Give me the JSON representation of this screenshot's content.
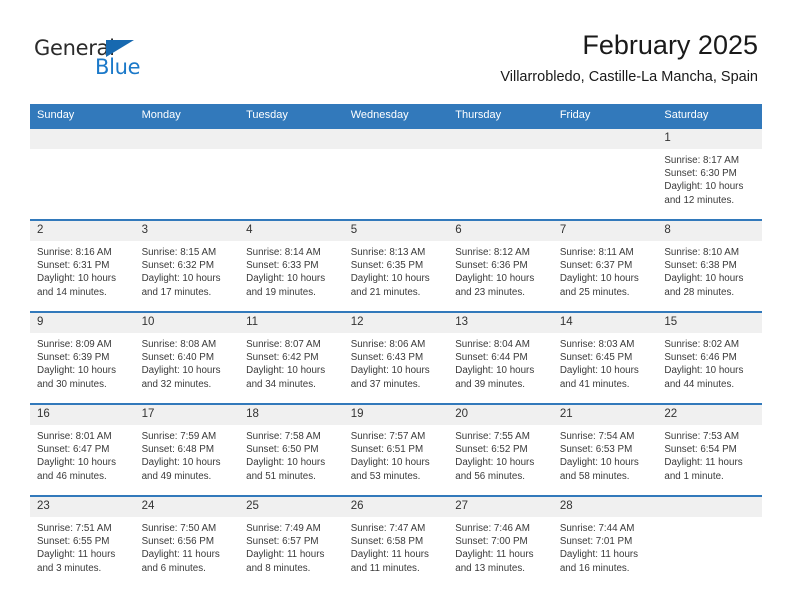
{
  "logo": {
    "word1": "General",
    "word2": "Blue",
    "triangle_color": "#1769b0",
    "word2_color": "#1b79c9"
  },
  "header": {
    "title": "February 2025",
    "subtitle": "Villarrobledo, Castille-La Mancha, Spain"
  },
  "theme": {
    "header_bg": "#3279bb",
    "row_divider": "#3279bb",
    "daynum_bg": "#f0f0f0",
    "text": "#3a3a3a"
  },
  "calendar": {
    "weekday_headers": [
      "Sunday",
      "Monday",
      "Tuesday",
      "Wednesday",
      "Thursday",
      "Friday",
      "Saturday"
    ],
    "weeks": [
      [
        {
          "day": "",
          "sunrise": "",
          "sunset": "",
          "daylight": ""
        },
        {
          "day": "",
          "sunrise": "",
          "sunset": "",
          "daylight": ""
        },
        {
          "day": "",
          "sunrise": "",
          "sunset": "",
          "daylight": ""
        },
        {
          "day": "",
          "sunrise": "",
          "sunset": "",
          "daylight": ""
        },
        {
          "day": "",
          "sunrise": "",
          "sunset": "",
          "daylight": ""
        },
        {
          "day": "",
          "sunrise": "",
          "sunset": "",
          "daylight": ""
        },
        {
          "day": "1",
          "sunrise": "Sunrise: 8:17 AM",
          "sunset": "Sunset: 6:30 PM",
          "daylight": "Daylight: 10 hours and 12 minutes."
        }
      ],
      [
        {
          "day": "2",
          "sunrise": "Sunrise: 8:16 AM",
          "sunset": "Sunset: 6:31 PM",
          "daylight": "Daylight: 10 hours and 14 minutes."
        },
        {
          "day": "3",
          "sunrise": "Sunrise: 8:15 AM",
          "sunset": "Sunset: 6:32 PM",
          "daylight": "Daylight: 10 hours and 17 minutes."
        },
        {
          "day": "4",
          "sunrise": "Sunrise: 8:14 AM",
          "sunset": "Sunset: 6:33 PM",
          "daylight": "Daylight: 10 hours and 19 minutes."
        },
        {
          "day": "5",
          "sunrise": "Sunrise: 8:13 AM",
          "sunset": "Sunset: 6:35 PM",
          "daylight": "Daylight: 10 hours and 21 minutes."
        },
        {
          "day": "6",
          "sunrise": "Sunrise: 8:12 AM",
          "sunset": "Sunset: 6:36 PM",
          "daylight": "Daylight: 10 hours and 23 minutes."
        },
        {
          "day": "7",
          "sunrise": "Sunrise: 8:11 AM",
          "sunset": "Sunset: 6:37 PM",
          "daylight": "Daylight: 10 hours and 25 minutes."
        },
        {
          "day": "8",
          "sunrise": "Sunrise: 8:10 AM",
          "sunset": "Sunset: 6:38 PM",
          "daylight": "Daylight: 10 hours and 28 minutes."
        }
      ],
      [
        {
          "day": "9",
          "sunrise": "Sunrise: 8:09 AM",
          "sunset": "Sunset: 6:39 PM",
          "daylight": "Daylight: 10 hours and 30 minutes."
        },
        {
          "day": "10",
          "sunrise": "Sunrise: 8:08 AM",
          "sunset": "Sunset: 6:40 PM",
          "daylight": "Daylight: 10 hours and 32 minutes."
        },
        {
          "day": "11",
          "sunrise": "Sunrise: 8:07 AM",
          "sunset": "Sunset: 6:42 PM",
          "daylight": "Daylight: 10 hours and 34 minutes."
        },
        {
          "day": "12",
          "sunrise": "Sunrise: 8:06 AM",
          "sunset": "Sunset: 6:43 PM",
          "daylight": "Daylight: 10 hours and 37 minutes."
        },
        {
          "day": "13",
          "sunrise": "Sunrise: 8:04 AM",
          "sunset": "Sunset: 6:44 PM",
          "daylight": "Daylight: 10 hours and 39 minutes."
        },
        {
          "day": "14",
          "sunrise": "Sunrise: 8:03 AM",
          "sunset": "Sunset: 6:45 PM",
          "daylight": "Daylight: 10 hours and 41 minutes."
        },
        {
          "day": "15",
          "sunrise": "Sunrise: 8:02 AM",
          "sunset": "Sunset: 6:46 PM",
          "daylight": "Daylight: 10 hours and 44 minutes."
        }
      ],
      [
        {
          "day": "16",
          "sunrise": "Sunrise: 8:01 AM",
          "sunset": "Sunset: 6:47 PM",
          "daylight": "Daylight: 10 hours and 46 minutes."
        },
        {
          "day": "17",
          "sunrise": "Sunrise: 7:59 AM",
          "sunset": "Sunset: 6:48 PM",
          "daylight": "Daylight: 10 hours and 49 minutes."
        },
        {
          "day": "18",
          "sunrise": "Sunrise: 7:58 AM",
          "sunset": "Sunset: 6:50 PM",
          "daylight": "Daylight: 10 hours and 51 minutes."
        },
        {
          "day": "19",
          "sunrise": "Sunrise: 7:57 AM",
          "sunset": "Sunset: 6:51 PM",
          "daylight": "Daylight: 10 hours and 53 minutes."
        },
        {
          "day": "20",
          "sunrise": "Sunrise: 7:55 AM",
          "sunset": "Sunset: 6:52 PM",
          "daylight": "Daylight: 10 hours and 56 minutes."
        },
        {
          "day": "21",
          "sunrise": "Sunrise: 7:54 AM",
          "sunset": "Sunset: 6:53 PM",
          "daylight": "Daylight: 10 hours and 58 minutes."
        },
        {
          "day": "22",
          "sunrise": "Sunrise: 7:53 AM",
          "sunset": "Sunset: 6:54 PM",
          "daylight": "Daylight: 11 hours and 1 minute."
        }
      ],
      [
        {
          "day": "23",
          "sunrise": "Sunrise: 7:51 AM",
          "sunset": "Sunset: 6:55 PM",
          "daylight": "Daylight: 11 hours and 3 minutes."
        },
        {
          "day": "24",
          "sunrise": "Sunrise: 7:50 AM",
          "sunset": "Sunset: 6:56 PM",
          "daylight": "Daylight: 11 hours and 6 minutes."
        },
        {
          "day": "25",
          "sunrise": "Sunrise: 7:49 AM",
          "sunset": "Sunset: 6:57 PM",
          "daylight": "Daylight: 11 hours and 8 minutes."
        },
        {
          "day": "26",
          "sunrise": "Sunrise: 7:47 AM",
          "sunset": "Sunset: 6:58 PM",
          "daylight": "Daylight: 11 hours and 11 minutes."
        },
        {
          "day": "27",
          "sunrise": "Sunrise: 7:46 AM",
          "sunset": "Sunset: 7:00 PM",
          "daylight": "Daylight: 11 hours and 13 minutes."
        },
        {
          "day": "28",
          "sunrise": "Sunrise: 7:44 AM",
          "sunset": "Sunset: 7:01 PM",
          "daylight": "Daylight: 11 hours and 16 minutes."
        },
        {
          "day": "",
          "sunrise": "",
          "sunset": "",
          "daylight": ""
        }
      ]
    ]
  }
}
